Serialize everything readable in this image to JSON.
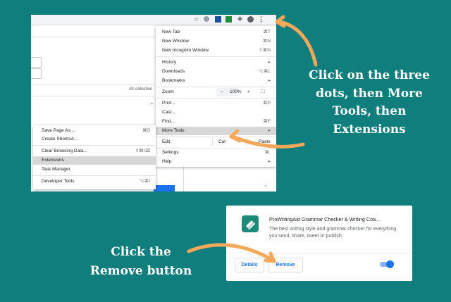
{
  "toolbar_icons": [
    "star-icon",
    "extension-a-icon",
    "extension-b-icon",
    "extension-c-icon",
    "puzzle-icon",
    "avatar",
    "three-dots-icon"
  ],
  "background_page": {
    "all_collections": "All collection"
  },
  "chrome_menu": {
    "items": [
      {
        "label": "New Tab",
        "shortcut": "⌘T"
      },
      {
        "label": "New Window",
        "shortcut": "⌘N"
      },
      {
        "label": "New Incognito Window",
        "shortcut": "⇧⌘N"
      },
      {
        "label": "History",
        "shortcut": "▸"
      },
      {
        "label": "Downloads",
        "shortcut": "⌥⌘L"
      },
      {
        "label": "Bookmarks",
        "shortcut": "▸"
      },
      {
        "label": "Zoom",
        "shortcut": ""
      },
      {
        "label": "Print...",
        "shortcut": "⌘P"
      },
      {
        "label": "Cast...",
        "shortcut": ""
      },
      {
        "label": "Find...",
        "shortcut": "⌘F"
      },
      {
        "label": "More Tools",
        "shortcut": "▸"
      },
      {
        "label": "Edit",
        "shortcut": ""
      },
      {
        "label": "Settings",
        "shortcut": "⌘,"
      },
      {
        "label": "Help",
        "shortcut": "▸"
      }
    ],
    "zoom": {
      "minus": "–",
      "value": "100%",
      "plus": "+",
      "fullscreen": "⛶"
    },
    "edit": {
      "cut": "Cut",
      "paste": "Paste"
    }
  },
  "more_tools_submenu": {
    "items": [
      {
        "label": "Save Page As...",
        "shortcut": "⌘S"
      },
      {
        "label": "Create Shortcut...",
        "shortcut": ""
      },
      {
        "label": "Clear Browsing Data...",
        "shortcut": "⇧⌘⌫"
      },
      {
        "label": "Extensions",
        "shortcut": ""
      },
      {
        "label": "Task Manager",
        "shortcut": ""
      },
      {
        "label": "Developer Tools",
        "shortcut": "⌥⌘I"
      }
    ]
  },
  "callout_top": [
    "Click on the three",
    "dots, then More",
    "Tools, then",
    "Extensions"
  ],
  "callout_bottom": [
    "Click the",
    "Remove button"
  ],
  "extension_card": {
    "title": "ProWritingAid Grammar Checker & Writing Coa...",
    "description": "The best writing style and grammar checker for everything you send, share, tweet or publish.",
    "details_label": "Details",
    "remove_label": "Remove",
    "toggle_on": true,
    "accent_color": "#1a73e8"
  },
  "colors": {
    "background": "#107e7d",
    "arrow": "#f5a85a",
    "highlight": "#d7d7d7"
  }
}
